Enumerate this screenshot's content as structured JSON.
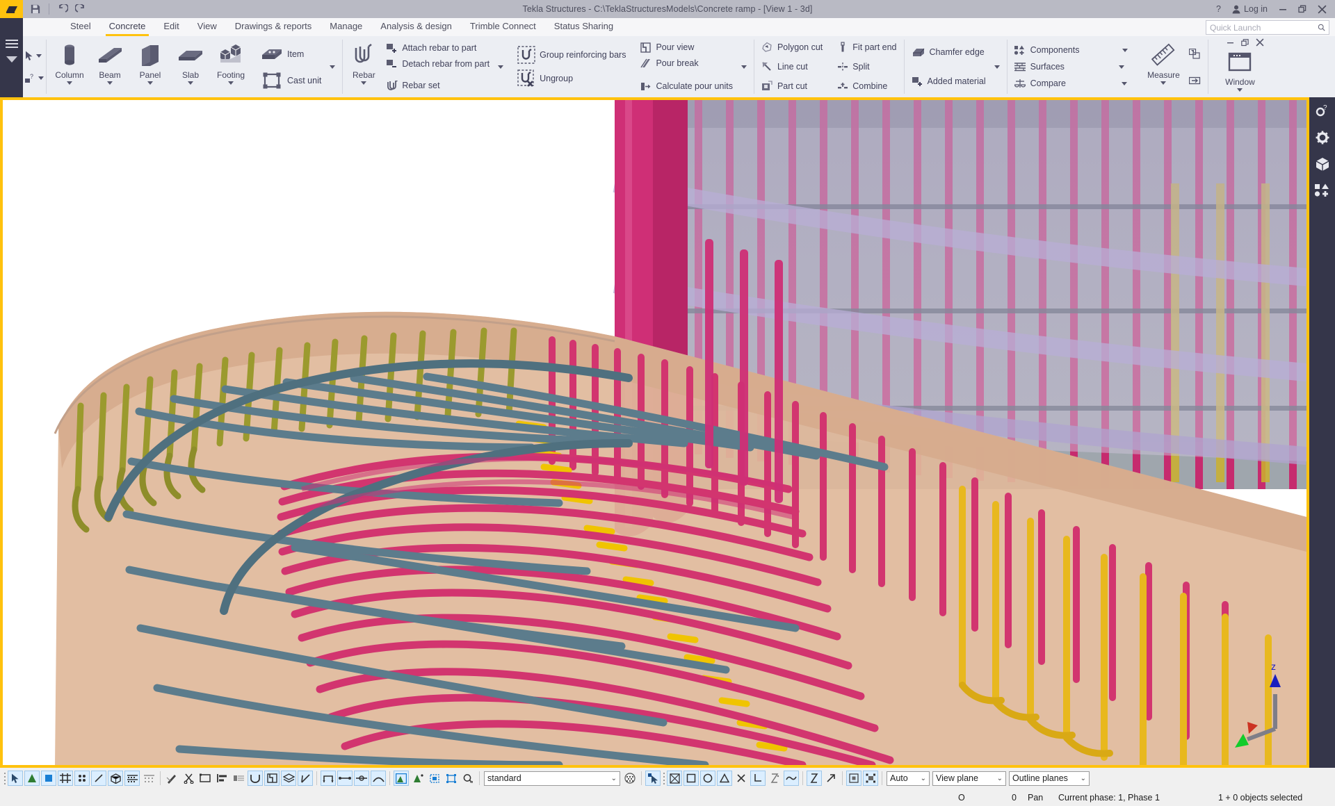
{
  "titlebar": {
    "title": "Tekla Structures - C:\\TeklaStructuresModels\\Concrete ramp  - [View 1 - 3d]",
    "logo_name": "tekla-logo",
    "quick_access": [
      "save",
      "undo",
      "redo"
    ],
    "help_label": "?",
    "login_label": "Log in",
    "minimize_label": "—",
    "restore_label": "❐",
    "close_label": "✕"
  },
  "tabs": [
    {
      "label": "Steel",
      "active": false
    },
    {
      "label": "Concrete",
      "active": true
    },
    {
      "label": "Edit",
      "active": false
    },
    {
      "label": "View",
      "active": false
    },
    {
      "label": "Drawings & reports",
      "active": false
    },
    {
      "label": "Manage",
      "active": false
    },
    {
      "label": "Analysis & design",
      "active": false
    },
    {
      "label": "Trimble Connect",
      "active": false
    },
    {
      "label": "Status Sharing",
      "active": false
    }
  ],
  "quick_launch": {
    "placeholder": "Quick Launch",
    "value": ""
  },
  "ribbon": {
    "big_buttons": [
      {
        "label": "Column",
        "icon": "column-icon",
        "has_dropdown": true
      },
      {
        "label": "Beam",
        "icon": "beam-icon",
        "has_dropdown": true
      },
      {
        "label": "Panel",
        "icon": "panel-icon",
        "has_dropdown": true
      },
      {
        "label": "Slab",
        "icon": "slab-icon",
        "has_dropdown": true
      },
      {
        "label": "Footing",
        "icon": "footing-icon",
        "has_dropdown": true
      }
    ],
    "item_group": [
      {
        "label": "Item",
        "icon": "item-icon"
      },
      {
        "label": "Cast unit",
        "icon": "cast-unit-icon"
      }
    ],
    "rebar_button": {
      "label": "Rebar",
      "icon": "rebar-icon",
      "has_dropdown": true
    },
    "rebar_group": [
      {
        "label": "Attach rebar to part",
        "icon": "attach-rebar-icon"
      },
      {
        "label": "Detach rebar from part",
        "icon": "detach-rebar-icon"
      },
      {
        "label": "Rebar set",
        "icon": "rebar-set-icon"
      }
    ],
    "group_group": [
      {
        "label": "Group reinforcing bars",
        "icon": "group-rebar-icon"
      },
      {
        "label": "Ungroup",
        "icon": "ungroup-icon"
      }
    ],
    "pour_group": [
      {
        "label": "Pour view",
        "icon": "pour-view-icon"
      },
      {
        "label": "Pour break",
        "icon": "pour-break-icon"
      },
      {
        "label": "Calculate pour units",
        "icon": "calculate-pour-units-icon"
      }
    ],
    "cut_group": [
      {
        "label": "Polygon cut",
        "icon": "polygon-cut-icon"
      },
      {
        "label": "Line cut",
        "icon": "line-cut-icon"
      },
      {
        "label": "Part cut",
        "icon": "part-cut-icon"
      }
    ],
    "fit_group": [
      {
        "label": "Fit part end",
        "icon": "fit-part-end-icon"
      },
      {
        "label": "Split",
        "icon": "split-icon"
      },
      {
        "label": "Combine",
        "icon": "combine-icon"
      }
    ],
    "detail_group": [
      {
        "label": "Chamfer edge",
        "icon": "chamfer-edge-icon"
      },
      {
        "label": "Added material",
        "icon": "added-material-icon"
      }
    ],
    "components_group": [
      {
        "label": "Components",
        "icon": "components-icon"
      },
      {
        "label": "Surfaces",
        "icon": "surfaces-icon"
      },
      {
        "label": "Compare",
        "icon": "compare-icon"
      }
    ],
    "measure_button": {
      "label": "Measure",
      "icon": "measure-ruler-icon",
      "has_dropdown": true
    },
    "window_button": {
      "label": "Window",
      "icon": "window-icon",
      "has_dropdown": true
    },
    "window_controls": {
      "minimize": "—",
      "restore": "❐",
      "close": "✕"
    }
  },
  "right_rail": [
    {
      "name": "gear-question-icon"
    },
    {
      "name": "gear-icon"
    },
    {
      "name": "cube-icon"
    },
    {
      "name": "components-icon"
    }
  ],
  "viewport": {
    "axis_label_z": "z",
    "model_description": "3D rendered concrete ramp with reinforcement bars"
  },
  "bottom_toolbar": {
    "snap_buttons": [
      {
        "name": "select-arrow",
        "on": true
      },
      {
        "name": "snap-point-triangle",
        "on": true
      },
      {
        "name": "snap-square",
        "on": true
      },
      {
        "name": "snap-grid-lines",
        "on": true
      },
      {
        "name": "snap-points-4",
        "on": true
      },
      {
        "name": "snap-line",
        "on": true
      },
      {
        "name": "snap-solid-cube",
        "on": true
      },
      {
        "name": "snap-grid-dense",
        "on": true
      },
      {
        "name": "snap-grid-sparse",
        "on": false
      },
      {
        "name": "snap-nearest",
        "on": false
      },
      {
        "name": "snap-cut-scissors",
        "on": false
      },
      {
        "name": "snap-rectangle",
        "on": false
      },
      {
        "name": "snap-align",
        "on": false
      },
      {
        "name": "snap-extend",
        "on": false
      },
      {
        "name": "snap-u-shape",
        "on": true
      },
      {
        "name": "snap-pour-view",
        "on": true
      },
      {
        "name": "snap-layers",
        "on": true
      },
      {
        "name": "snap-angle",
        "on": true
      }
    ],
    "ortho_buttons": [
      {
        "name": "ortho-step",
        "on": true
      },
      {
        "name": "ortho-horizontal",
        "on": true
      },
      {
        "name": "ortho-mid",
        "on": true
      },
      {
        "name": "ortho-arc",
        "on": true
      }
    ],
    "view_buttons": [
      {
        "name": "render-view",
        "on": true
      },
      {
        "name": "point-view",
        "on": false
      },
      {
        "name": "select-region",
        "on": false
      },
      {
        "name": "select-box",
        "on": false
      },
      {
        "name": "zoom-query",
        "on": false
      }
    ],
    "setting_combo": {
      "value": "standard",
      "name": "settings-combo"
    },
    "transparency_icon": "transparency-icon",
    "select-switch": {
      "name": "select-mode-icon",
      "on": true
    },
    "select_filters": [
      {
        "name": "select-all-icon",
        "on": true
      },
      {
        "name": "select-part-icon",
        "on": true
      },
      {
        "name": "select-circle-icon",
        "on": true
      },
      {
        "name": "select-triangle-icon",
        "on": true
      },
      {
        "name": "select-cross-icon",
        "on": false
      },
      {
        "name": "select-corner-icon",
        "on": true
      },
      {
        "name": "select-hourglass-dot-icon",
        "on": false
      },
      {
        "name": "select-wave-icon",
        "on": true
      },
      {
        "name": "select-hourglass-icon",
        "on": true
      },
      {
        "name": "select-arrow-up-icon",
        "on": false
      },
      {
        "name": "select-square-small-icon",
        "on": true
      },
      {
        "name": "select-box-handles-icon",
        "on": true
      }
    ],
    "combos": [
      {
        "label": "Auto",
        "name": "auto-combo"
      },
      {
        "label": "View plane",
        "name": "view-plane-combo"
      },
      {
        "label": "Outline planes",
        "name": "outline-planes-combo"
      }
    ]
  },
  "statusbar": {
    "coord_x": "O",
    "coord_y": "0",
    "mode": "Pan",
    "phase": "Current phase: 1, Phase 1",
    "selection": "1 + 0 objects selected"
  }
}
